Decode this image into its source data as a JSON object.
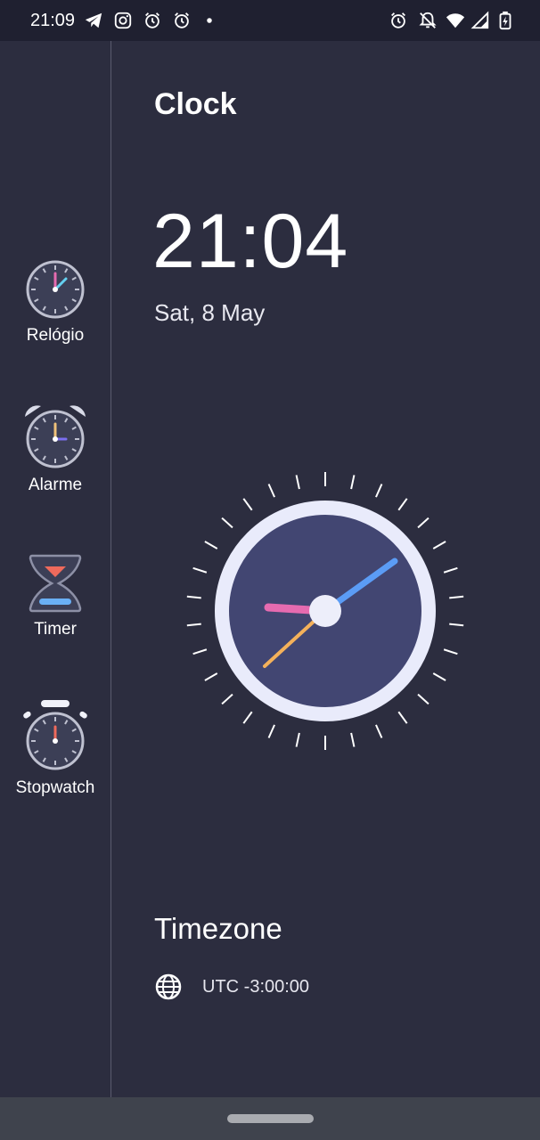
{
  "status_bar": {
    "time": "21:09",
    "left_icons": [
      "telegram-icon",
      "instagram-icon",
      "alarm-icon",
      "alarm-icon",
      "dot-icon"
    ],
    "right_icons": [
      "alarm-icon",
      "notifications-off-icon",
      "wifi-icon",
      "signal-icon",
      "battery-charging-icon"
    ]
  },
  "sidebar": {
    "items": [
      {
        "label": "Relógio",
        "icon": "clock-icon"
      },
      {
        "label": "Alarme",
        "icon": "alarm-clock-icon"
      },
      {
        "label": "Timer",
        "icon": "hourglass-icon"
      },
      {
        "label": "Stopwatch",
        "icon": "stopwatch-icon"
      }
    ]
  },
  "main": {
    "title": "Clock",
    "time": "21:04",
    "date": "Sat, 8 May",
    "timezone_title": "Timezone",
    "timezone_value": "UTC -3:00:00",
    "timezone_icon": "globe-icon"
  },
  "colors": {
    "background": "#2c2d3f",
    "clock_face": "#424672",
    "clock_rim": "#e9ebfb",
    "hour_hand": "#e66bb0",
    "minute_hand": "#5b9cf5",
    "second_hand": "#f4b15a"
  }
}
